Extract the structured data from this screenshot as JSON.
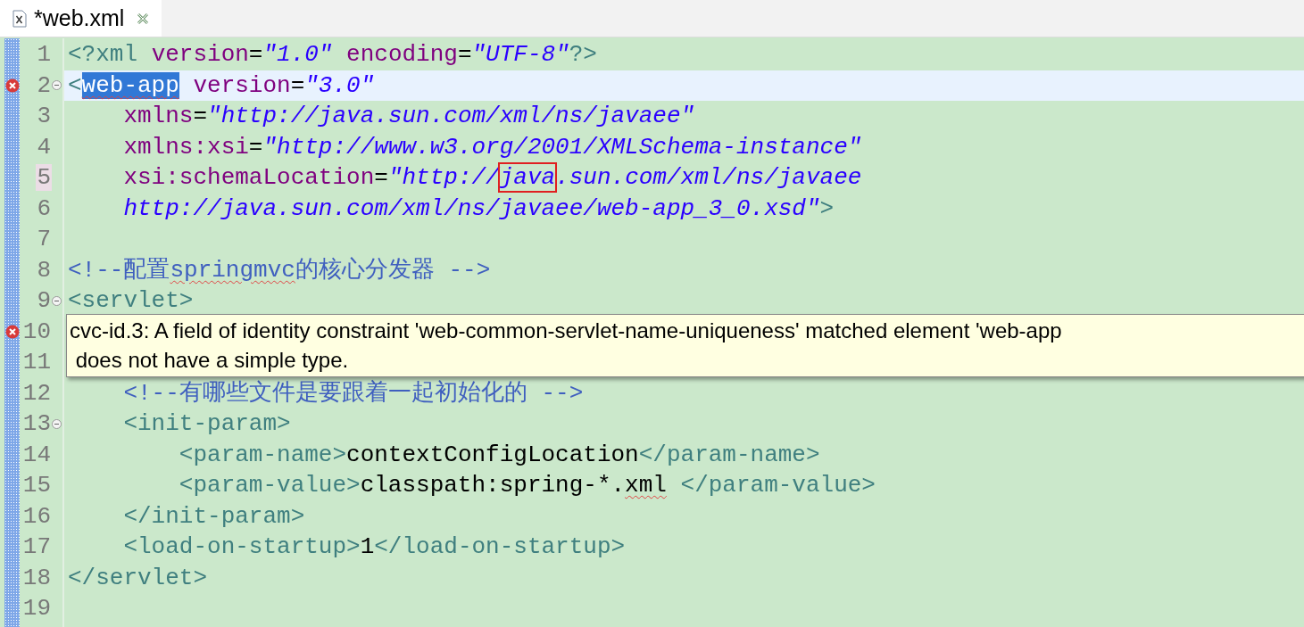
{
  "tab": {
    "title": "*web.xml",
    "selected": true
  },
  "lines": [
    {
      "number": "1",
      "error": false,
      "fold": false,
      "current": false,
      "marked": false,
      "segments": [
        {
          "kind": "tag",
          "text": "<?xml "
        },
        {
          "kind": "attr",
          "text": "version"
        },
        {
          "kind": "eq",
          "text": "="
        },
        {
          "kind": "string",
          "text": "\"1.0\""
        },
        {
          "kind": "attr",
          "text": " encoding"
        },
        {
          "kind": "eq",
          "text": "="
        },
        {
          "kind": "string",
          "text": "\"UTF-8\""
        },
        {
          "kind": "tag",
          "text": "?>"
        }
      ]
    },
    {
      "number": "2",
      "error": true,
      "fold": true,
      "current": true,
      "marked": false,
      "segments": [
        {
          "kind": "tag",
          "text": "<"
        },
        {
          "kind": "tag",
          "text": "web-app",
          "selected": true,
          "squiggle": true
        },
        {
          "kind": "attr",
          "text": " version"
        },
        {
          "kind": "eq",
          "text": "="
        },
        {
          "kind": "string",
          "text": "\"3.0\""
        }
      ]
    },
    {
      "number": "3",
      "error": false,
      "fold": false,
      "current": false,
      "marked": false,
      "segments": [
        {
          "kind": "attr",
          "text": "    xmlns"
        },
        {
          "kind": "eq",
          "text": "="
        },
        {
          "kind": "string",
          "text": "\"http://java.sun.com/xml/ns/javaee\""
        }
      ]
    },
    {
      "number": "4",
      "error": false,
      "fold": false,
      "current": false,
      "marked": false,
      "segments": [
        {
          "kind": "attr",
          "text": "    xmlns:xsi"
        },
        {
          "kind": "eq",
          "text": "="
        },
        {
          "kind": "string",
          "text": "\"http://www.w3.org/2001/XMLSchema-instance\""
        }
      ]
    },
    {
      "number": "5",
      "error": false,
      "fold": false,
      "current": false,
      "marked": true,
      "segments": [
        {
          "kind": "attr",
          "text": "    xsi:schemaLocation"
        },
        {
          "kind": "eq",
          "text": "="
        },
        {
          "kind": "string",
          "text": "\"http://"
        },
        {
          "kind": "string",
          "text": "java",
          "boxed": true
        },
        {
          "kind": "string",
          "text": ".sun.com/xml/ns/javaee"
        }
      ]
    },
    {
      "number": "6",
      "error": false,
      "fold": false,
      "current": false,
      "marked": false,
      "segments": [
        {
          "kind": "string",
          "text": "    http://java.sun.com/xml/ns/javaee/web-app_3_0.xsd\""
        },
        {
          "kind": "tag",
          "text": ">"
        }
      ]
    },
    {
      "number": "7",
      "error": false,
      "fold": false,
      "current": false,
      "marked": false
    },
    {
      "number": "8",
      "error": false,
      "fold": false,
      "current": false,
      "marked": false,
      "segments": [
        {
          "kind": "comment",
          "text": "<!--配置"
        },
        {
          "kind": "comment",
          "text": "springmvc",
          "squiggle": true
        },
        {
          "kind": "comment",
          "text": "的核心分发器 -->"
        }
      ]
    },
    {
      "number": "9",
      "error": false,
      "fold": true,
      "current": false,
      "marked": false,
      "segments": [
        {
          "kind": "tag",
          "text": "<servlet>"
        }
      ]
    },
    {
      "number": "10",
      "error": true,
      "fold": false,
      "current": false,
      "marked": false
    },
    {
      "number": "11",
      "error": false,
      "fold": false,
      "current": false,
      "marked": false
    },
    {
      "number": "12",
      "error": false,
      "fold": false,
      "current": false,
      "marked": false,
      "segments": [
        {
          "kind": "comment",
          "text": "    <!--有哪些文件是要跟着一起初始化的 -->"
        }
      ]
    },
    {
      "number": "13",
      "error": false,
      "fold": true,
      "current": false,
      "marked": false,
      "segments": [
        {
          "kind": "tag",
          "text": "    <init-param>"
        }
      ]
    },
    {
      "number": "14",
      "error": false,
      "fold": false,
      "current": false,
      "marked": false,
      "segments": [
        {
          "kind": "tag",
          "text": "        <param-name>"
        },
        {
          "kind": "text",
          "text": "contextConfigLocation"
        },
        {
          "kind": "tag",
          "text": "</param-name>"
        }
      ]
    },
    {
      "number": "15",
      "error": false,
      "fold": false,
      "current": false,
      "marked": false,
      "segments": [
        {
          "kind": "tag",
          "text": "        <param-value>"
        },
        {
          "kind": "text",
          "text": "classpath:spring-*."
        },
        {
          "kind": "text",
          "text": "xml",
          "squiggle": true
        },
        {
          "kind": "tag",
          "text": " </param-value>"
        }
      ]
    },
    {
      "number": "16",
      "error": false,
      "fold": false,
      "current": false,
      "marked": false,
      "segments": [
        {
          "kind": "tag",
          "text": "    </init-param>"
        }
      ]
    },
    {
      "number": "17",
      "error": false,
      "fold": false,
      "current": false,
      "marked": false,
      "segments": [
        {
          "kind": "tag",
          "text": "    <load-on-startup>"
        },
        {
          "kind": "text",
          "text": "1"
        },
        {
          "kind": "tag",
          "text": "</load-on-startup>"
        }
      ]
    },
    {
      "number": "18",
      "error": false,
      "fold": false,
      "current": false,
      "marked": false,
      "segments": [
        {
          "kind": "tag",
          "text": "</servlet>"
        }
      ]
    },
    {
      "number": "19",
      "error": false,
      "fold": false,
      "current": false,
      "marked": false
    }
  ],
  "tooltip": {
    "lines": [
      "cvc-id.3: A field of identity constraint 'web-common-servlet-name-uniqueness' matched element 'web-app",
      " does not have a simple type."
    ]
  }
}
